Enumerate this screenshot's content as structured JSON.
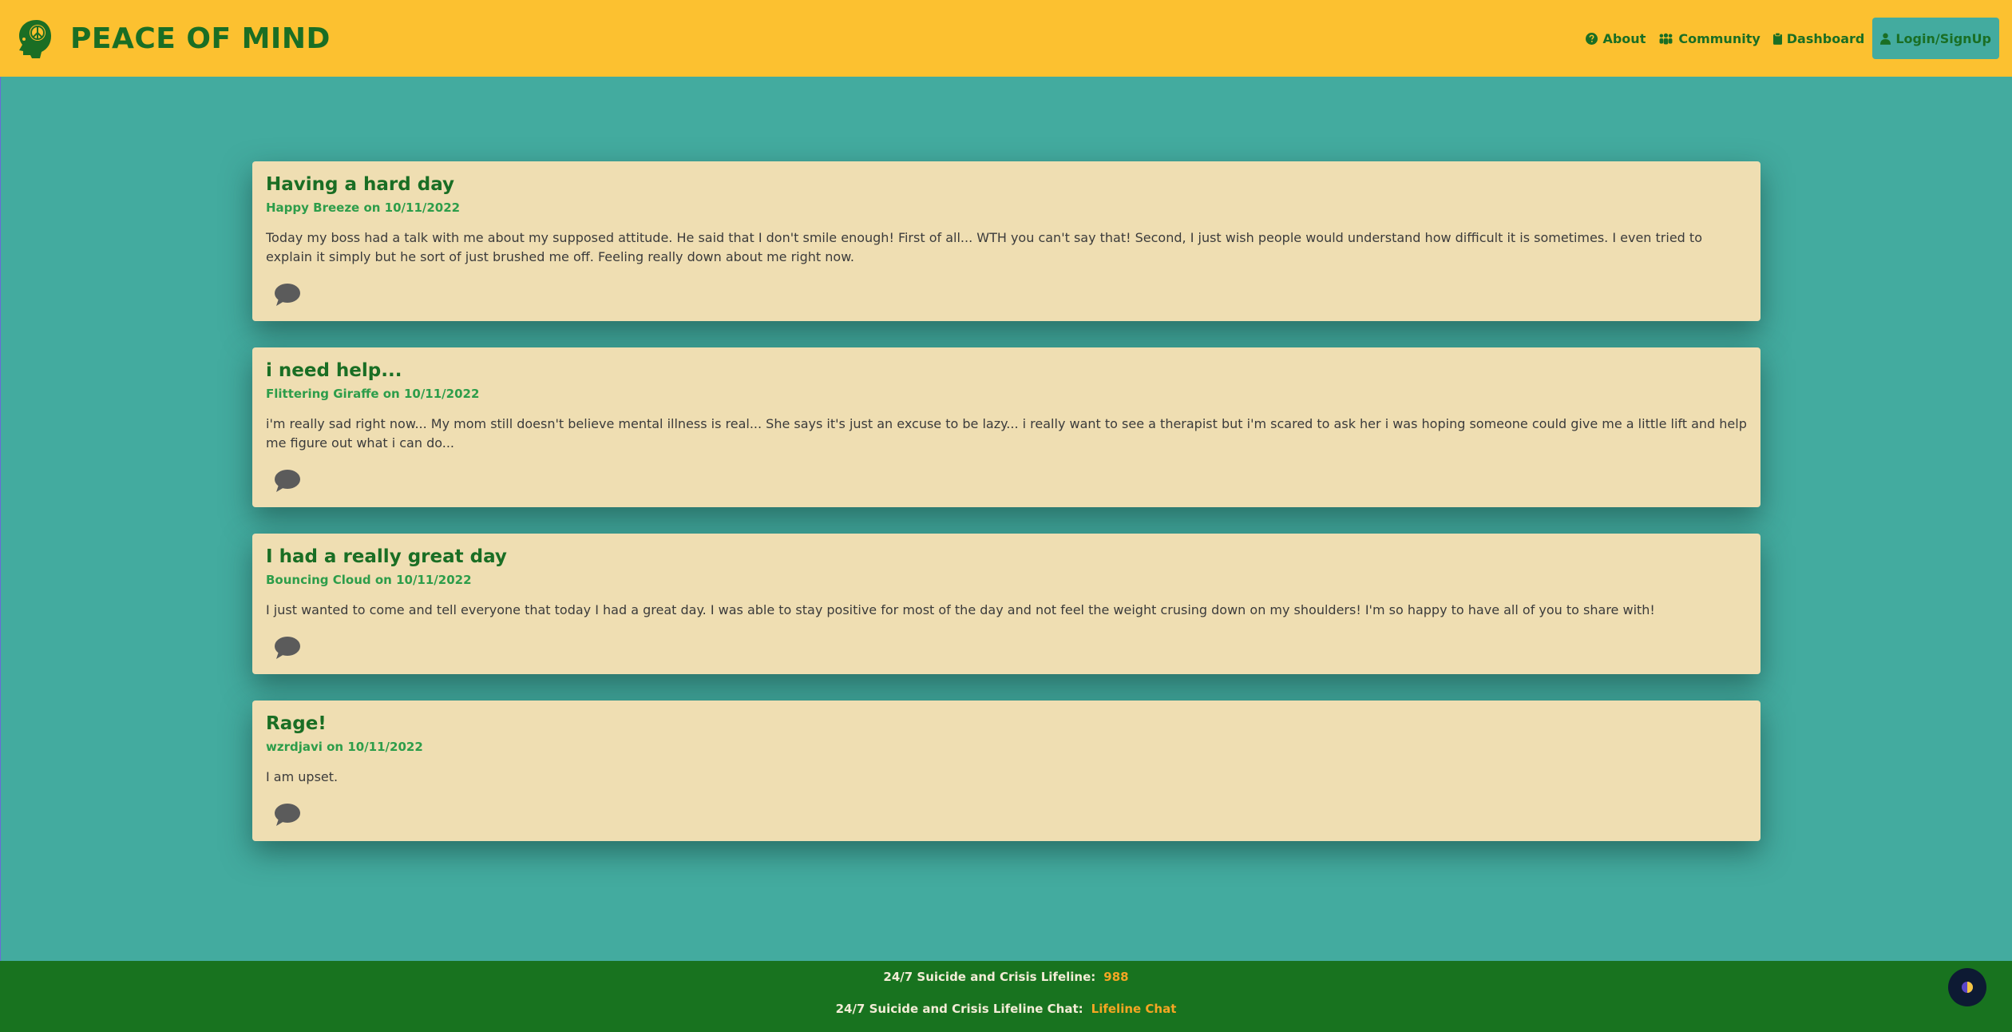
{
  "header": {
    "brand_name": "PEACE OF MIND",
    "logo_icon": "head-peace-logo-icon",
    "nav": [
      {
        "label": "About",
        "icon": "question-circle-icon"
      },
      {
        "label": "Community",
        "icon": "people-icon"
      },
      {
        "label": "Dashboard",
        "icon": "clipboard-icon"
      },
      {
        "label": "Login/SignUp",
        "icon": "person-icon"
      }
    ]
  },
  "posts": [
    {
      "title": "Having a hard day",
      "meta": "Happy Breeze on 10/11/2022",
      "body": "Today my boss had a talk with me about my supposed attitude. He said that I don't smile enough! First of all... WTH you can't say that! Second, I just wish people would understand how difficult it is sometimes. I even tried to explain it simply but he sort of just brushed me off. Feeling really down about me right now."
    },
    {
      "title": "i need help...",
      "meta": "Flittering Giraffe on 10/11/2022",
      "body": "i'm really sad right now... My mom still doesn't believe mental illness is real... She says it's just an excuse to be lazy... i really want to see a therapist but i'm scared to ask her i was hoping someone could give me a little lift and help me figure out what i can do..."
    },
    {
      "title": "I had a really great day",
      "meta": "Bouncing Cloud on 10/11/2022",
      "body": "I just wanted to come and tell everyone that today I had a great day. I was able to stay positive for most of the day and not feel the weight crusing down on my shoulders! I'm so happy to have all of you to share with!"
    },
    {
      "title": "Rage!",
      "meta": "wzrdjavi on 10/11/2022",
      "body": "I am upset."
    }
  ],
  "footer": {
    "lifeline_label": "24/7 Suicide and Crisis Lifeline:",
    "lifeline_number": "988",
    "chat_label": "24/7 Suicide and Crisis Lifeline Chat:",
    "chat_link": "Lifeline Chat"
  },
  "colors": {
    "header_bg": "#fcc130",
    "page_bg": "#43ab9f",
    "card_bg": "#efdeb2",
    "brand_green": "#1a6e24",
    "meta_green": "#2d9d4a",
    "footer_bg": "#18731f",
    "footer_link": "#f5a623"
  }
}
